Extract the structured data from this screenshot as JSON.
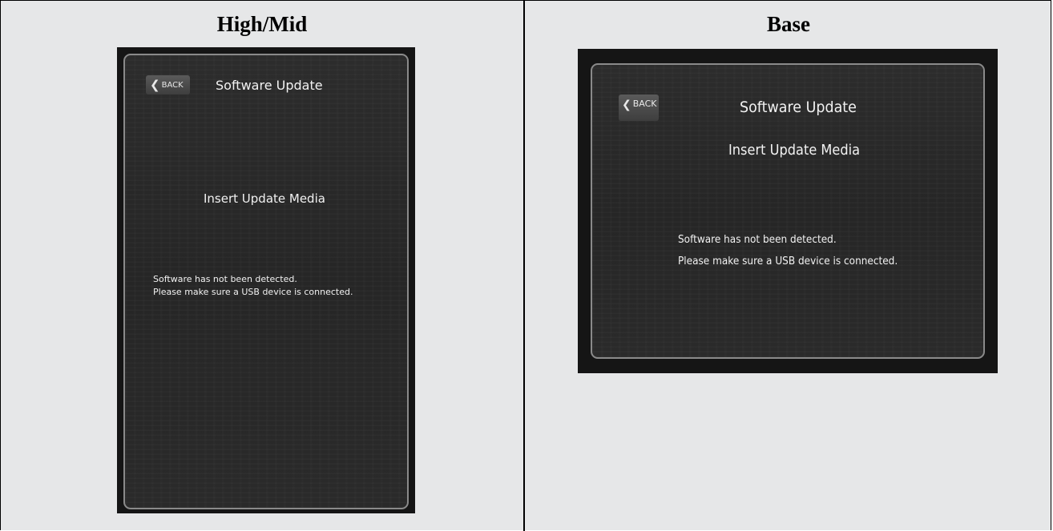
{
  "columns": {
    "left_title": "High/Mid",
    "right_title": "Base"
  },
  "screens": {
    "high_mid": {
      "back_label": "BACK",
      "title": "Software Update",
      "subtitle": "Insert Update Media",
      "message_line1": "Software has not been detected.",
      "message_line2": "Please make sure a USB device is connected."
    },
    "base": {
      "back_label": "BACK",
      "title": "Software Update",
      "subtitle": "Insert Update Media",
      "message_line1": "Software has not been detected.",
      "message_line2": "Please make sure a USB device is connected."
    }
  },
  "icons": {
    "back": "chevron-left-icon"
  },
  "colors": {
    "panel_background": "#e6e7e8",
    "screen_background": "#151515",
    "screen_border": "#8a8a8a",
    "text": "#f2f2f2"
  }
}
